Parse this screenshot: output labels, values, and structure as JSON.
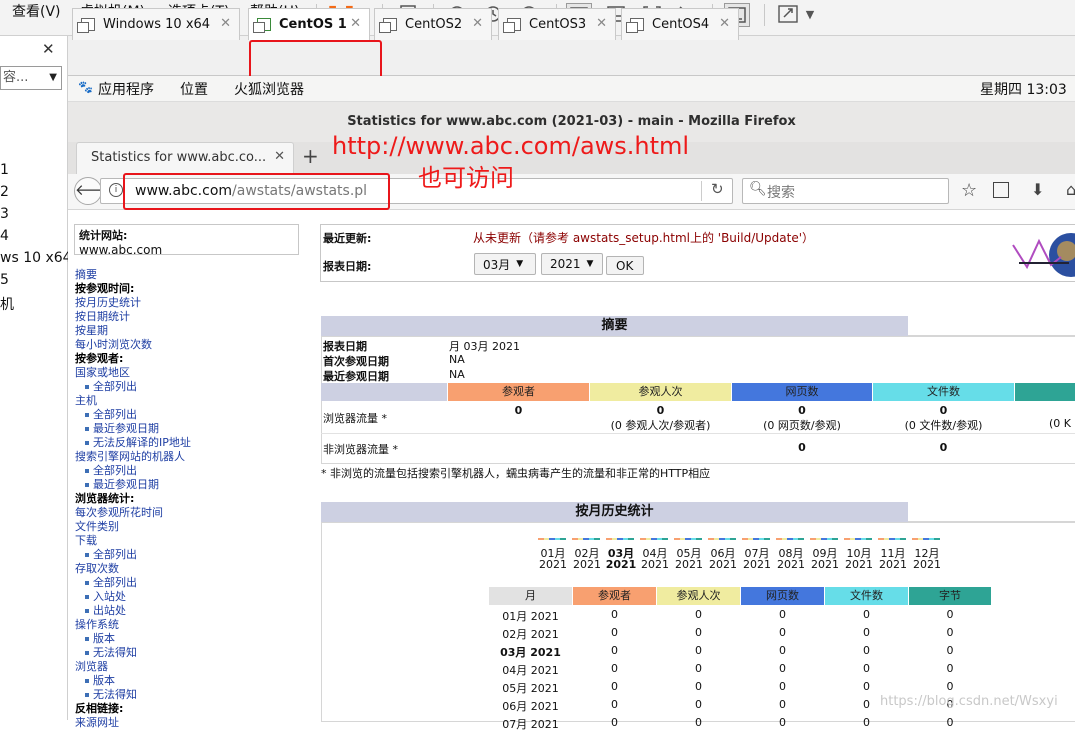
{
  "vmware": {
    "menus": [
      "查看(V)",
      "虚拟机(M)",
      "选项卡(T)",
      "帮助(H)"
    ],
    "tabs": [
      {
        "label": "Windows 10 x64"
      },
      {
        "label": "CentOS 1"
      },
      {
        "label": "CentOS2"
      },
      {
        "label": "CentOS3"
      },
      {
        "label": "CentOS4"
      }
    ],
    "library": {
      "search_placeholder": "容...",
      "items": [
        "1",
        "2",
        "3",
        "4",
        "ws 10 x64",
        "5",
        "机"
      ]
    }
  },
  "gnome": {
    "apps": "应用程序",
    "places": "位置",
    "browser": "火狐浏览器",
    "clock": "星期四 13:03"
  },
  "firefox": {
    "window_title": "Statistics for www.abc.com (2021-03) - main - Mozilla Firefox",
    "tab_title": "Statistics for www.abc.co...",
    "url_domain": "www.abc.com",
    "url_path": "/awstats/awstats.pl",
    "search_placeholder": "搜索"
  },
  "annotation": {
    "line1": "http://www.abc.com/aws.html",
    "line2": "也可访问"
  },
  "awstats": {
    "site_label": "统计网站:",
    "site": "www.abc.com",
    "last_update_label": "最近更新:",
    "last_update": "从未更新（请参考 awstats_setup.html上的 'Build/Update'）",
    "report_date_label": "报表日期:",
    "month": "03月",
    "year": "2021",
    "ok": "OK",
    "nav": [
      {
        "t": "摘要"
      },
      {
        "t": "按参观时间:",
        "h": 1
      },
      {
        "t": "按月历史统计"
      },
      {
        "t": "按日期统计"
      },
      {
        "t": "按星期"
      },
      {
        "t": "每小时浏览次数"
      },
      {
        "t": "按参观者:",
        "h": 1
      },
      {
        "t": "国家或地区"
      },
      {
        "t": "全部列出",
        "s": 1
      },
      {
        "t": "主机"
      },
      {
        "t": "全部列出",
        "s": 1
      },
      {
        "t": "最近参观日期",
        "s": 1
      },
      {
        "t": "无法反解译的IP地址",
        "s": 1
      },
      {
        "t": "搜索引擎网站的机器人"
      },
      {
        "t": "全部列出",
        "s": 1
      },
      {
        "t": "最近参观日期",
        "s": 1
      },
      {
        "t": "浏览器统计:",
        "h": 1
      },
      {
        "t": "每次参观所花时间"
      },
      {
        "t": "文件类别"
      },
      {
        "t": "下载"
      },
      {
        "t": "全部列出",
        "s": 1
      },
      {
        "t": "存取次数"
      },
      {
        "t": "全部列出",
        "s": 1
      },
      {
        "t": "入站处",
        "s": 1
      },
      {
        "t": "出站处",
        "s": 1
      },
      {
        "t": "操作系统"
      },
      {
        "t": "版本",
        "s": 1
      },
      {
        "t": "无法得知",
        "s": 1
      },
      {
        "t": "浏览器"
      },
      {
        "t": "版本",
        "s": 1
      },
      {
        "t": "无法得知",
        "s": 1
      },
      {
        "t": "反相链接:",
        "h": 1
      },
      {
        "t": "来源网址"
      }
    ],
    "summary": {
      "title": "摘要",
      "rows": [
        [
          "报表日期",
          "月 03月 2021"
        ],
        [
          "首次参观日期",
          "NA"
        ],
        [
          "最近参观日期",
          "NA"
        ]
      ],
      "cols": [
        "参观者",
        "参观人次",
        "网页数",
        "文件数"
      ],
      "browser_label": "浏览器流量 *",
      "browser_vals": [
        "0",
        "0",
        "0",
        "0"
      ],
      "browser_sub": [
        "",
        "(0 参观人次/参观者)",
        "(0 网页数/参观)",
        "(0 文件数/参观)",
        "(0 K"
      ],
      "nonbrowser_label": "非浏览器流量 *",
      "nonbrowser_vals": [
        "0",
        "0"
      ],
      "note": "* 非浏览的流量包括搜索引擎机器人，蠕虫病毒产生的流量和非正常的HTTP相应"
    },
    "monthly": {
      "title": "按月历史统计",
      "months": [
        "01月",
        "02月",
        "03月",
        "04月",
        "05月",
        "06月",
        "07月",
        "08月",
        "09月",
        "10月",
        "11月",
        "12月"
      ],
      "year": "2021",
      "cols": [
        "月",
        "参观者",
        "参观人次",
        "网页数",
        "文件数",
        "字节"
      ],
      "rows": [
        [
          "01月 2021",
          "0",
          "0",
          "0",
          "0",
          "0"
        ],
        [
          "02月 2021",
          "0",
          "0",
          "0",
          "0",
          "0"
        ],
        [
          "03月 2021",
          "0",
          "0",
          "0",
          "0",
          "0"
        ],
        [
          "04月 2021",
          "0",
          "0",
          "0",
          "0",
          "0"
        ],
        [
          "05月 2021",
          "0",
          "0",
          "0",
          "0",
          "0"
        ],
        [
          "06月 2021",
          "0",
          "0",
          "0",
          "0",
          "0"
        ],
        [
          "07月 2021",
          "0",
          "0",
          "0",
          "0",
          "0"
        ]
      ]
    }
  },
  "watermark": "https://blog.csdn.net/Wsxyi",
  "colors": {
    "visitors": "#f8a070",
    "visits": "#f0eca0",
    "pages": "#4477dd",
    "files": "#66dde8",
    "bytes": "#2ea495",
    "section_head": "#cdd0e2",
    "annotation": "#ee1a1a"
  }
}
